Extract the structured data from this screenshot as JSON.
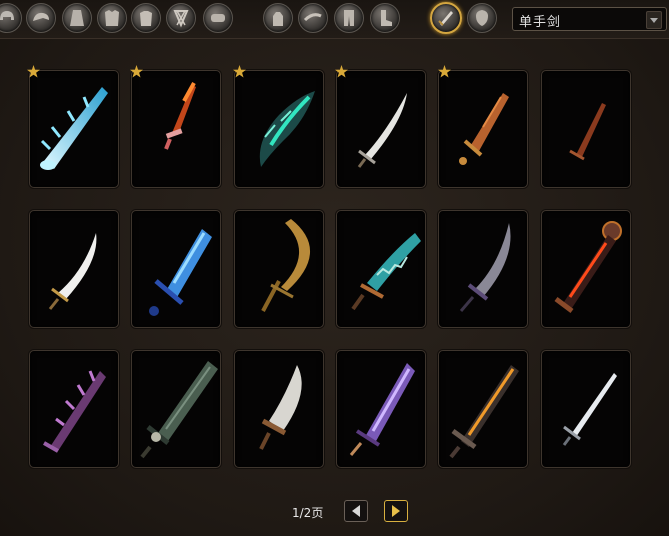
{
  "filter": {
    "selected": "单手剑"
  },
  "pagination": {
    "page_text": "1/2页"
  },
  "slot_icons": [
    "helmet-icon",
    "shoulder-icon",
    "cloak-icon",
    "chest-icon",
    "shirt-icon",
    "tabard-icon",
    "bracers-icon",
    "gloves-icon",
    "belt-icon",
    "legs-icon",
    "boots-icon",
    "one-hand-sword-icon",
    "shield-icon"
  ],
  "weapons": [
    {
      "icon": "frost-sword-icon",
      "starred": true
    },
    {
      "icon": "flame-dagger-icon",
      "starred": true
    },
    {
      "icon": "fel-blade-icon",
      "starred": true
    },
    {
      "icon": "curved-silver-sword-icon",
      "starred": true
    },
    {
      "icon": "bronze-sword-icon",
      "starred": true
    },
    {
      "icon": "small-rust-sword-icon",
      "starred": false
    },
    {
      "icon": "scimitar-icon",
      "starred": false
    },
    {
      "icon": "crystal-blue-sword-icon",
      "starred": false
    },
    {
      "icon": "golden-crescent-blade-icon",
      "starred": false
    },
    {
      "icon": "teal-serrated-blade-icon",
      "starred": false
    },
    {
      "icon": "dark-curved-blade-icon",
      "starred": false
    },
    {
      "icon": "molten-sword-icon",
      "starred": false
    },
    {
      "icon": "spiked-purple-blade-icon",
      "starred": false
    },
    {
      "icon": "jade-broadsword-icon",
      "starred": false
    },
    {
      "icon": "cleaver-sword-icon",
      "starred": false
    },
    {
      "icon": "arcane-sword-icon",
      "starred": false
    },
    {
      "icon": "ember-greatblade-icon",
      "starred": false
    },
    {
      "icon": "steel-longsword-icon",
      "starred": false
    }
  ],
  "colors": {
    "star": "#d9a938",
    "selected_ring": "#d4a640"
  }
}
